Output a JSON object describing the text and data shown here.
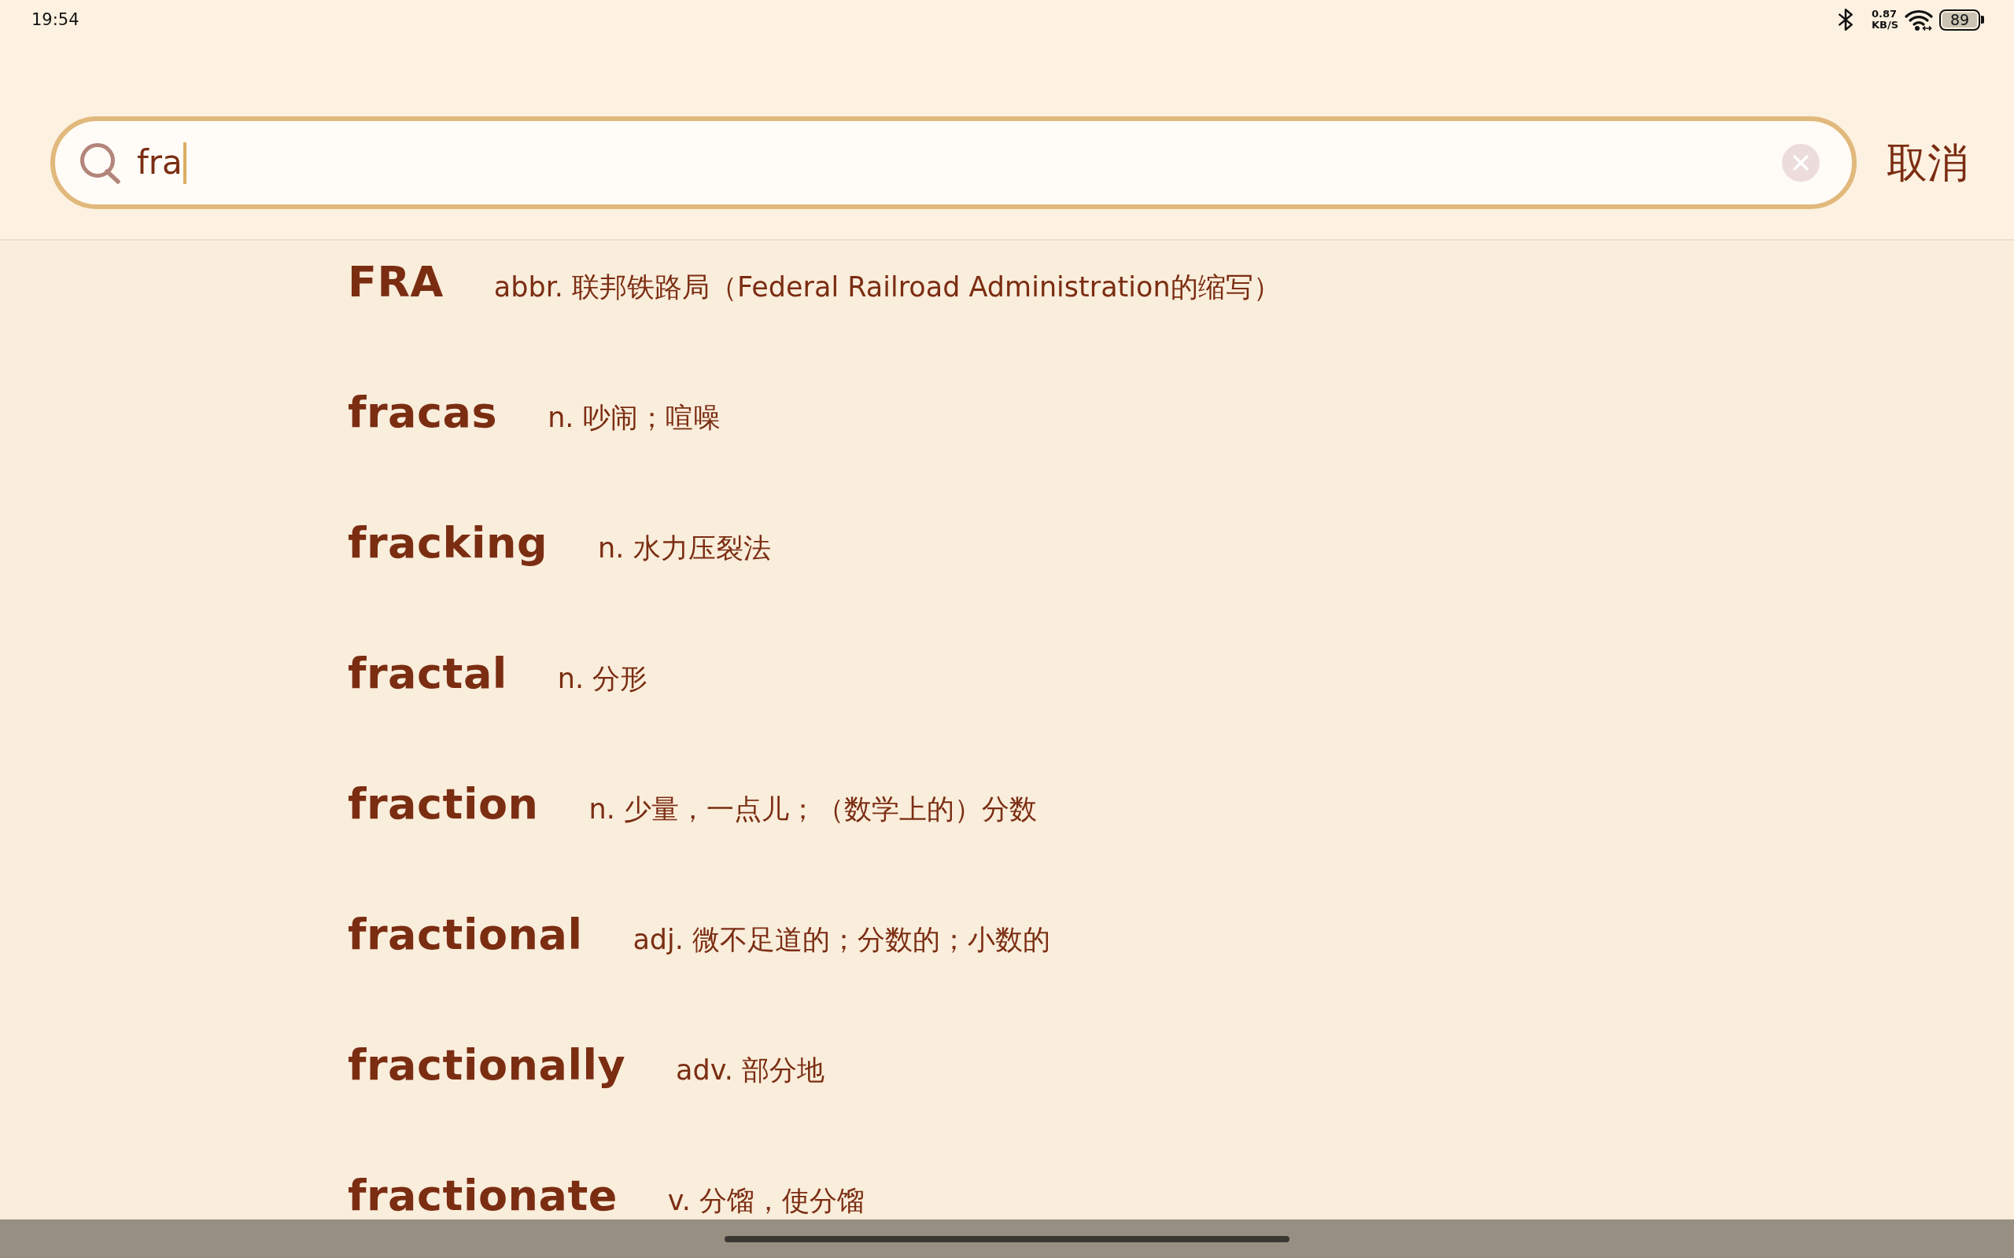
{
  "status_bar": {
    "time": "19:54",
    "net_speed": "0.87",
    "net_speed_unit": "KB/S",
    "battery": "89"
  },
  "search": {
    "value": "fra",
    "cancel": "取消"
  },
  "results": [
    {
      "word": "FRA",
      "definition": "abbr. 联邦铁路局（Federal Railroad Administration的缩写）"
    },
    {
      "word": "fracas",
      "definition": "n. 吵闹；喧噪"
    },
    {
      "word": "fracking",
      "definition": "n. 水力压裂法"
    },
    {
      "word": "fractal",
      "definition": "n. 分形"
    },
    {
      "word": "fraction",
      "definition": "n. 少量，一点儿；（数学上的）分数"
    },
    {
      "word": "fractional",
      "definition": "adj. 微不足道的；分数的；小数的"
    },
    {
      "word": "fractionally",
      "definition": "adv. 部分地"
    },
    {
      "word": "fractionate",
      "definition": "v. 分馏，使分馏"
    }
  ]
}
